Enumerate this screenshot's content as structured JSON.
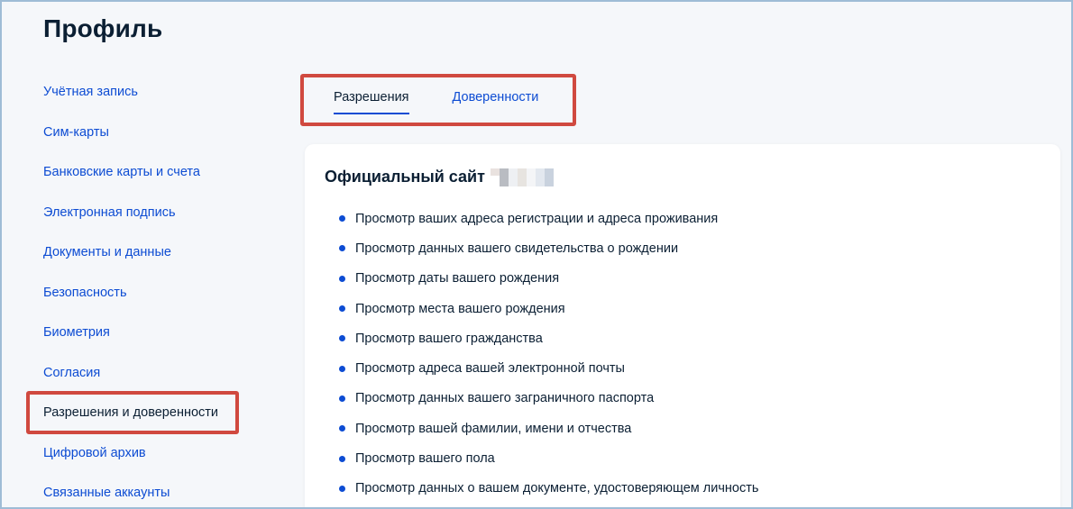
{
  "page": {
    "title": "Профиль"
  },
  "sidebar": {
    "items": [
      {
        "label": "Учётная запись"
      },
      {
        "label": "Сим-карты"
      },
      {
        "label": "Банковские карты и счета"
      },
      {
        "label": "Электронная подпись"
      },
      {
        "label": "Документы и данные"
      },
      {
        "label": "Безопасность"
      },
      {
        "label": "Биометрия"
      },
      {
        "label": "Согласия"
      },
      {
        "label": "Разрешения и доверенности",
        "active": true
      },
      {
        "label": "Цифровой архив"
      },
      {
        "label": "Связанные аккаунты"
      }
    ]
  },
  "tabs": [
    {
      "label": "Разрешения",
      "active": true
    },
    {
      "label": "Доверенности",
      "active": false
    }
  ],
  "card": {
    "title": "Официальный сайт",
    "permissions": [
      "Просмотр ваших адреса регистрации и адреса проживания",
      "Просмотр данных вашего свидетельства о рождении",
      "Просмотр даты вашего рождения",
      "Просмотр места вашего рождения",
      "Просмотр вашего гражданства",
      "Просмотр адреса вашей электронной почты",
      "Просмотр данных вашего заграничного паспорта",
      "Просмотр вашей фамилии, имени и отчества",
      "Просмотр вашего пола",
      "Просмотр данных о вашем документе, удостоверяющем личность"
    ]
  },
  "colors": {
    "link": "#0d4cd3",
    "text": "#0b1f33",
    "background": "#f5f7fa",
    "highlight": "#d0493f",
    "bullet": "#0d4cd3"
  }
}
